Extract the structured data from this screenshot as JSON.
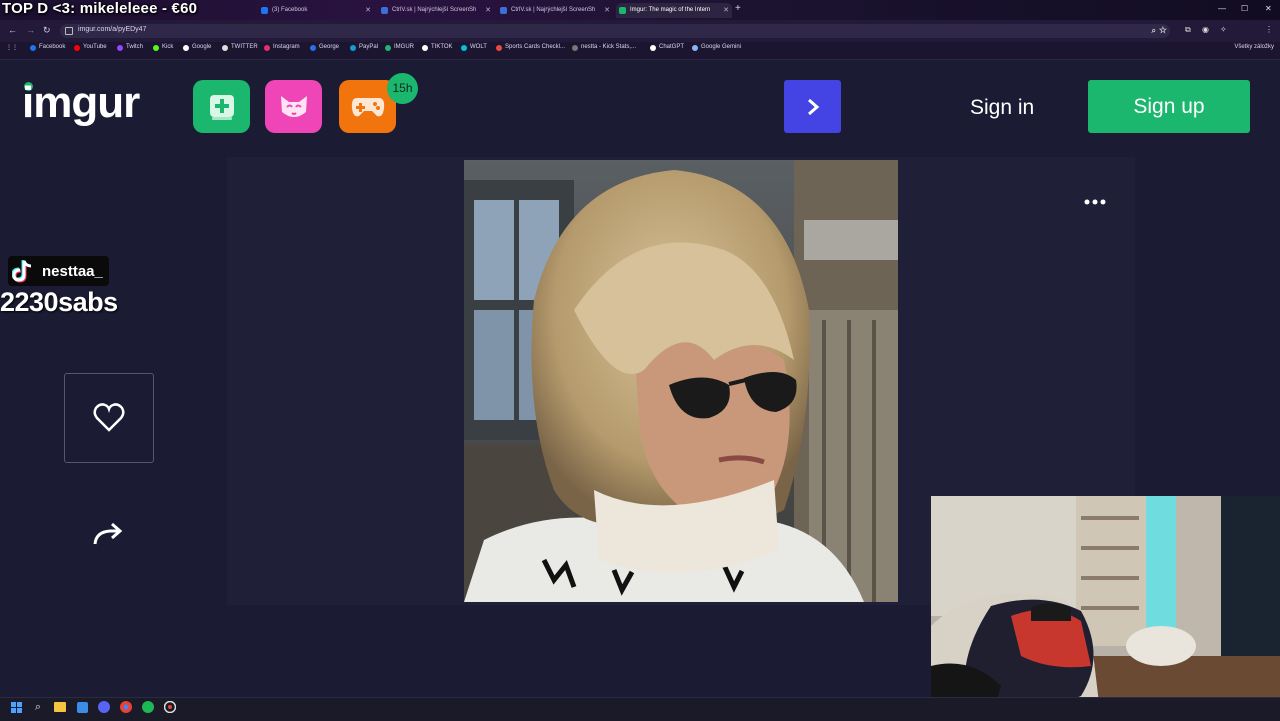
{
  "stream_overlay": {
    "top_donor": "TOP D <3: mikeleleee - €60",
    "tiktok_handle": "nesttaa_",
    "subs_count": "2230sabs"
  },
  "browser": {
    "tabs": [
      {
        "title": "(3) Facebook",
        "fav_color": "#1877f2"
      },
      {
        "title": "CtrlV.sk | Najrýchlejší ScreenSh",
        "fav_color": "#3b6fd8"
      },
      {
        "title": "CtrlV.sk | Najrýchlejší ScreenSh",
        "fav_color": "#3b6fd8"
      },
      {
        "title": "Imgur: The magic of the Intern",
        "fav_color": "#1bb76e"
      }
    ],
    "url": "imgur.com/a/pyEDy47",
    "bookmarks": [
      {
        "label": "Facebook",
        "color": "#1877f2"
      },
      {
        "label": "YouTube",
        "color": "#ff0000"
      },
      {
        "label": "Twitch",
        "color": "#9146ff"
      },
      {
        "label": "Kick",
        "color": "#53fc18"
      },
      {
        "label": "Google",
        "color": "#ffffff"
      },
      {
        "label": "TWITTER",
        "color": "#dddddd"
      },
      {
        "label": "Instagram",
        "color": "#e1306c"
      },
      {
        "label": "George",
        "color": "#2870ed"
      },
      {
        "label": "PayPal",
        "color": "#179bd7"
      },
      {
        "label": "IMGUR",
        "color": "#1bb76e"
      },
      {
        "label": "TIKTOK",
        "color": "#ffffff"
      },
      {
        "label": "WOLT",
        "color": "#00c2e8"
      },
      {
        "label": "Sports Cards Checkl...",
        "color": "#e84c3d"
      },
      {
        "label": "nestta - Kick Stats,...",
        "color": "#777777"
      },
      {
        "label": "ChatGPT",
        "color": "#ffffff"
      },
      {
        "label": "Google Gemini",
        "color": "#8ab4f8"
      }
    ],
    "bookmarks_right": "Všetky záložky"
  },
  "imgur": {
    "logo_text": "imgur",
    "badge_text": "15h",
    "sign_in": "Sign in",
    "sign_up": "Sign up",
    "colors": {
      "background": "#1b1c33",
      "green": "#1bb76e",
      "pink": "#f045b7",
      "orange": "#f2740c",
      "blue": "#4444e4"
    }
  },
  "icons": {
    "new_post": "plus-square-icon",
    "memes": "cat-mask-icon",
    "games": "gamepad-icon",
    "next": "chevron-right-icon",
    "more": "ellipsis-icon",
    "like": "heart-icon",
    "share": "share-arrow-icon"
  }
}
